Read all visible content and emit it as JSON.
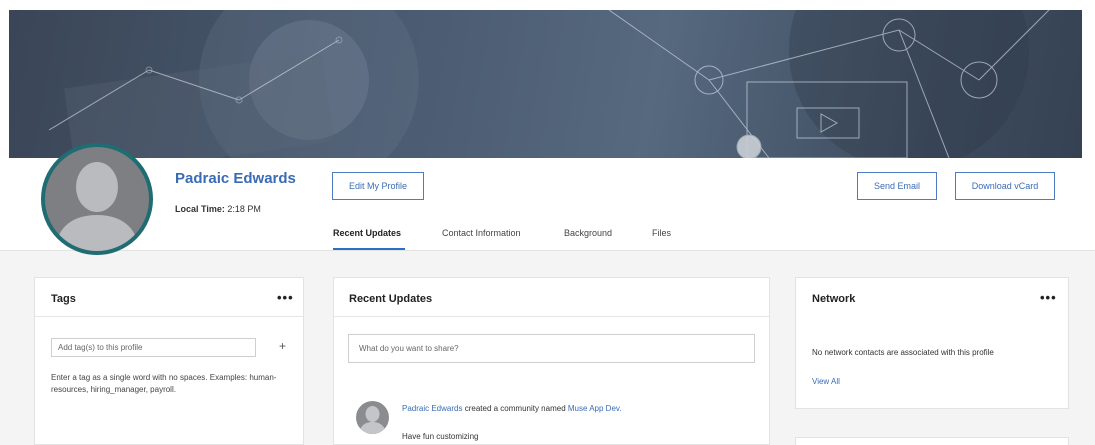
{
  "profile": {
    "name": "Padraic Edwards",
    "local_time_label": "Local Time:",
    "local_time_value": "2:18 PM"
  },
  "buttons": {
    "edit_profile": "Edit My Profile",
    "send_email": "Send Email",
    "download_vcard": "Download vCard"
  },
  "tabs": [
    {
      "label": "Recent Updates",
      "active": true
    },
    {
      "label": "Contact Information",
      "active": false
    },
    {
      "label": "Background",
      "active": false
    },
    {
      "label": "Files",
      "active": false
    }
  ],
  "tags_card": {
    "title": "Tags",
    "menu": "•••",
    "input_placeholder": "Add tag(s) to this profile",
    "add_symbol": "+",
    "help_text": "Enter a tag as a single word with no spaces. Examples: human-resources, hiring_manager, payroll."
  },
  "updates_card": {
    "title": "Recent Updates",
    "share_placeholder": "What do you want to share?",
    "post": {
      "author": "Padraic Edwards",
      "action": " created a community named ",
      "community": "Muse App Dev.",
      "subtext": "Have fun customizing"
    }
  },
  "network_card": {
    "title": "Network",
    "menu": "•••",
    "empty_text": "No network contacts are associated with this profile",
    "view_all": "View All"
  },
  "colors": {
    "accent": "#3a6cb5",
    "avatar_ring": "#1f6c73",
    "tab_underline": "#2f6fc1",
    "banner": "#4a5a70"
  }
}
